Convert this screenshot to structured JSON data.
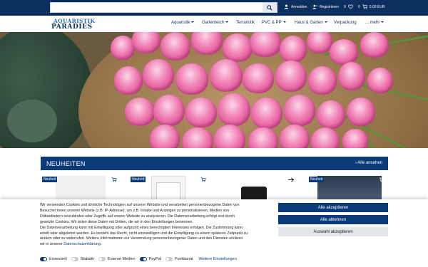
{
  "header": {
    "search_placeholder": "",
    "account_label": "Anmelden",
    "register_label": "Registrieren",
    "wishlist_count": "0",
    "cart_count": "0",
    "cart_total": "0,00 EUR"
  },
  "logo": {
    "line1": "AQUARISTIK",
    "line2": "PARADIES"
  },
  "nav": {
    "items": [
      {
        "label": "Aquaristik",
        "has_dropdown": true
      },
      {
        "label": "Gartenteich",
        "has_dropdown": true
      },
      {
        "label": "Terraristik",
        "has_dropdown": false
      },
      {
        "label": "PVC & PP",
        "has_dropdown": true
      },
      {
        "label": "Haus & Garten",
        "has_dropdown": true
      },
      {
        "label": "Verpackung",
        "has_dropdown": false
      },
      {
        "label": "... mehr",
        "has_dropdown": true
      }
    ]
  },
  "section": {
    "title": "NEUHEITEN",
    "all_link": "› Alle ansehen",
    "badges": [
      "Neuheit",
      "Neuheit",
      "Neuheit"
    ]
  },
  "cookie": {
    "text_lines": [
      "Wir verwenden Cookies und ähnliche Technologien auf unserer Website und verarbeiten personenbezogene Daten von",
      "Besucher:innen unserer Website (z.B. IP-Adresse), um z.B. Inhalte und Anzeigen zu personalisieren, Medien von",
      "Drittanbietern einzubinden oder Zugriffe auf unsere Website zu analysieren. Die Datenverarbeitung erfolgt erst durch",
      "gesetzte Cookies. Wir teilen diese Daten mit Dritten, die wir in den Einstellungen benennen.",
      "Die Datenverarbeitung kann mit Einwilligung oder aufgrund eines berechtigten Interesses erfolgen. Die Zustimmung kann",
      "erteilt oder abgelehnt werden. Es besteht das Recht, nicht einzuwilligen und die Einwilligung zu einem späteren Zeitpunkt zu",
      "ändern oder zu widerrufen. Weitere Informationen zur Verwendung personenbezogener Daten und den Diensten erklären"
    ],
    "last_line_prefix": "wir in unserer",
    "privacy_link": "Datenschutzerklärung",
    "last_line_suffix": ".",
    "accept_all": "Alle akzeptieren",
    "reject_all": "Alle ablehnen",
    "accept_selection": "Auswahl akzeptieren",
    "toggles": [
      {
        "label": "Essenziell",
        "on": true
      },
      {
        "label": "Statistik",
        "on": false
      },
      {
        "label": "Externe Medien",
        "on": false
      },
      {
        "label": "PayPal",
        "on": true
      },
      {
        "label": "Funktional",
        "on": false
      }
    ],
    "more_settings": "Weitere Einstellungen"
  },
  "colors": {
    "brand_dark": "#0b2f5e",
    "brand_blue": "#0b3a78",
    "logo_blue": "#2a6fb1"
  }
}
